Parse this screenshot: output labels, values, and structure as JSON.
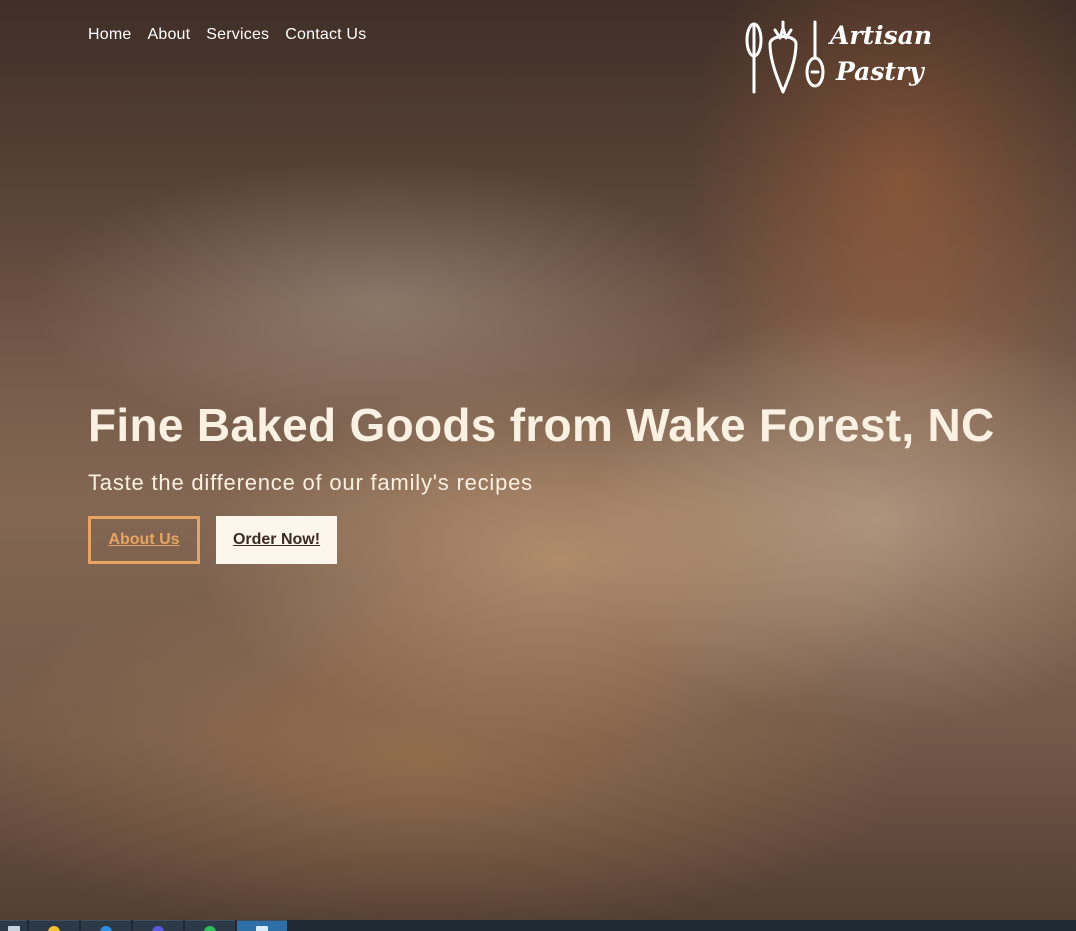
{
  "nav": {
    "items": [
      "Home",
      "About",
      "Services",
      "Contact Us"
    ]
  },
  "logo": {
    "line1": "Artisan",
    "line2": "Pastry"
  },
  "hero": {
    "headline": "Fine Baked Goods from Wake Forest, NC",
    "subline": "Taste the difference of our family's recipes",
    "about_button": "About Us",
    "order_button": "Order Now!"
  },
  "colors": {
    "accent": "#e7a463",
    "headline_text": "#fbf1e2",
    "order_button_bg": "#fdf6ec"
  },
  "taskbar": {
    "icons": [
      "window-icon",
      "drive-icon",
      "vscode-icon",
      "browser-icon",
      "chat-icon",
      "display-icon"
    ]
  }
}
